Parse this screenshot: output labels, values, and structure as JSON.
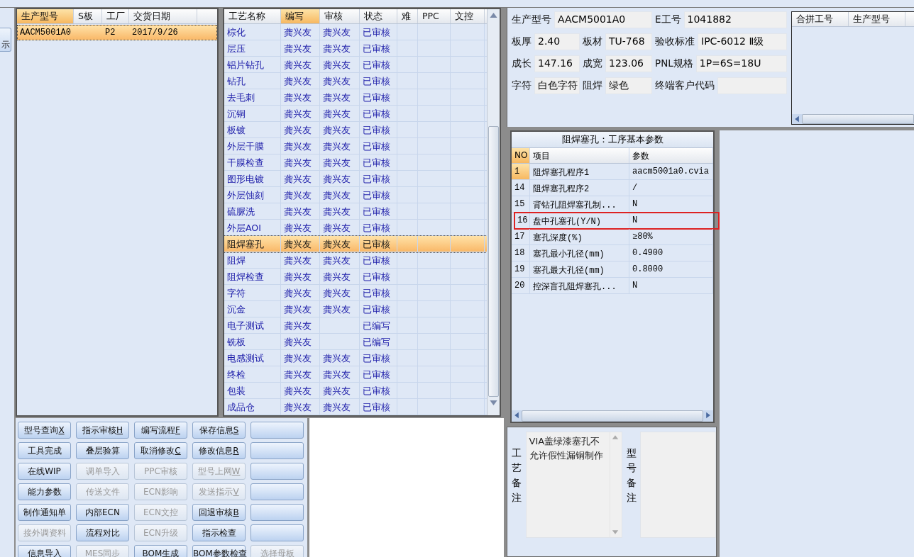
{
  "left_strip": {
    "button": "示"
  },
  "models_list": {
    "columns": [
      {
        "label": "生产型号",
        "sorted": true
      },
      {
        "label": "S板",
        "sorted": false
      },
      {
        "label": "工厂",
        "sorted": false
      },
      {
        "label": "交货日期",
        "sorted": false
      }
    ],
    "rows": [
      {
        "cells": [
          "AACM5001A0",
          "",
          "P2",
          "2017/9/26"
        ],
        "selected": true
      }
    ]
  },
  "process_table": {
    "columns": [
      {
        "label": "工艺名称",
        "sorted": false
      },
      {
        "label": "编写",
        "sorted": true
      },
      {
        "label": "审核",
        "sorted": false
      },
      {
        "label": "状态",
        "sorted": false
      },
      {
        "label": "难",
        "sorted": false
      },
      {
        "label": "PPC",
        "sorted": false
      },
      {
        "label": "文控",
        "sorted": false
      }
    ],
    "rows": [
      {
        "name": "棕化",
        "writer": "龚兴友",
        "reviewer": "龚兴友",
        "status": "已审核",
        "selected": false
      },
      {
        "name": "层压",
        "writer": "龚兴友",
        "reviewer": "龚兴友",
        "status": "已审核",
        "selected": false
      },
      {
        "name": "铝片钻孔",
        "writer": "龚兴友",
        "reviewer": "龚兴友",
        "status": "已审核",
        "selected": false
      },
      {
        "name": "钻孔",
        "writer": "龚兴友",
        "reviewer": "龚兴友",
        "status": "已审核",
        "selected": false
      },
      {
        "name": "去毛刺",
        "writer": "龚兴友",
        "reviewer": "龚兴友",
        "status": "已审核",
        "selected": false
      },
      {
        "name": "沉铜",
        "writer": "龚兴友",
        "reviewer": "龚兴友",
        "status": "已审核",
        "selected": false
      },
      {
        "name": "板镀",
        "writer": "龚兴友",
        "reviewer": "龚兴友",
        "status": "已审核",
        "selected": false
      },
      {
        "name": "外层干膜",
        "writer": "龚兴友",
        "reviewer": "龚兴友",
        "status": "已审核",
        "selected": false
      },
      {
        "name": "干膜检查",
        "writer": "龚兴友",
        "reviewer": "龚兴友",
        "status": "已审核",
        "selected": false
      },
      {
        "name": "图形电镀",
        "writer": "龚兴友",
        "reviewer": "龚兴友",
        "status": "已审核",
        "selected": false
      },
      {
        "name": "外层蚀刻",
        "writer": "龚兴友",
        "reviewer": "龚兴友",
        "status": "已审核",
        "selected": false
      },
      {
        "name": "硫脲洗",
        "writer": "龚兴友",
        "reviewer": "龚兴友",
        "status": "已审核",
        "selected": false
      },
      {
        "name": "外层AOI",
        "writer": "龚兴友",
        "reviewer": "龚兴友",
        "status": "已审核",
        "selected": false
      },
      {
        "name": "阻焊塞孔",
        "writer": "龚兴友",
        "reviewer": "龚兴友",
        "status": "已审核",
        "selected": true
      },
      {
        "name": "阻焊",
        "writer": "龚兴友",
        "reviewer": "龚兴友",
        "status": "已审核",
        "selected": false
      },
      {
        "name": "阻焊检查",
        "writer": "龚兴友",
        "reviewer": "龚兴友",
        "status": "已审核",
        "selected": false
      },
      {
        "name": "字符",
        "writer": "龚兴友",
        "reviewer": "龚兴友",
        "status": "已审核",
        "selected": false
      },
      {
        "name": "沉金",
        "writer": "龚兴友",
        "reviewer": "龚兴友",
        "status": "已审核",
        "selected": false
      },
      {
        "name": "电子测试",
        "writer": "龚兴友",
        "status": "已编写",
        "selected": false
      },
      {
        "name": "铣板",
        "writer": "龚兴友",
        "status": "已编写",
        "selected": false
      },
      {
        "name": "电感测试",
        "writer": "龚兴友",
        "reviewer": "龚兴友",
        "status": "已审核",
        "selected": false
      },
      {
        "name": "终检",
        "writer": "龚兴友",
        "reviewer": "龚兴友",
        "status": "已审核",
        "selected": false
      },
      {
        "name": "包装",
        "writer": "龚兴友",
        "reviewer": "龚兴友",
        "status": "已审核",
        "selected": false
      },
      {
        "name": "成品仓",
        "writer": "龚兴友",
        "reviewer": "龚兴友",
        "status": "已审核",
        "selected": false
      }
    ]
  },
  "buttons": [
    {
      "kind": "action",
      "label": "型号查询",
      "key": "X",
      "disabled": false
    },
    {
      "label": "指示审核",
      "key": "H",
      "disabled": false
    },
    {
      "label": "编写流程",
      "key": "F",
      "disabled": false
    },
    {
      "label": "保存信息",
      "key": "S",
      "disabled": false
    },
    {
      "kind": "blank",
      "disabled": false
    },
    {
      "label": "工具完成",
      "disabled": false
    },
    {
      "label": "叠层验算",
      "disabled": false
    },
    {
      "label": "取消修改",
      "key": "C",
      "disabled": false
    },
    {
      "label": "修改信息",
      "key": "R",
      "disabled": false
    },
    {
      "kind": "blank",
      "disabled": false
    },
    {
      "label": "在线WIP",
      "disabled": false
    },
    {
      "label": "调单导入",
      "disabled": true
    },
    {
      "label": "PPC审核",
      "disabled": true
    },
    {
      "label": "型号上网",
      "key": "W",
      "disabled": true
    },
    {
      "kind": "blank",
      "disabled": false
    },
    {
      "label": "能力参数",
      "disabled": false
    },
    {
      "label": "传送文件",
      "disabled": true
    },
    {
      "label": "ECN影响",
      "disabled": true
    },
    {
      "label": "发送指示",
      "key": "V",
      "disabled": true
    },
    {
      "kind": "blank",
      "disabled": false
    },
    {
      "label": "制作通知单",
      "disabled": false
    },
    {
      "label": "内部ECN",
      "disabled": false
    },
    {
      "label": "ECN文控",
      "disabled": true
    },
    {
      "label": "回退审核",
      "key": "B",
      "disabled": false
    },
    {
      "kind": "blank",
      "disabled": false
    },
    {
      "label": "接外调资料",
      "disabled": true
    },
    {
      "label": "流程对比",
      "disabled": false
    },
    {
      "label": "ECN升级",
      "disabled": true
    },
    {
      "label": "指示检查",
      "disabled": false
    },
    {
      "kind": "blank",
      "disabled": false
    },
    {
      "label": "信息导入",
      "disabled": false
    },
    {
      "label": "MES同步",
      "disabled": true
    },
    {
      "label": "BOM生成",
      "disabled": false
    },
    {
      "label": "BOM参数检查",
      "disabled": false
    },
    {
      "label": "选择母板",
      "disabled": true
    }
  ],
  "info": {
    "fields": [
      {
        "label": "生产型号",
        "value": "AACM5001A0"
      },
      {
        "label": "E工号",
        "value": "1041882"
      },
      {
        "label": "板厚",
        "value": "2.40"
      },
      {
        "label": "板材",
        "value": "TU-768"
      },
      {
        "label": "验收标准",
        "value": "IPC-6012 Ⅱ级"
      },
      {
        "label": "成长",
        "value": "147.16"
      },
      {
        "label": "成宽",
        "value": "123.06"
      },
      {
        "label": "PNL规格",
        "value": "1P=6S=18U"
      },
      {
        "label": "字符",
        "value": "白色字符"
      },
      {
        "label": "阻焊",
        "value": "绿色"
      },
      {
        "label": "终端客户代码"
      }
    ]
  },
  "merge_table": {
    "columns": [
      "合拼工号",
      "生产型号"
    ]
  },
  "params": {
    "title": "阻焊塞孔：工序基本参数",
    "columns": [
      "NO",
      "项目",
      "参数"
    ],
    "rows": [
      {
        "no": "1",
        "item": "阻焊塞孔程序1",
        "value": "aacm5001a0.cvia",
        "selected": true,
        "highlighted": false
      },
      {
        "no": "14",
        "item": "阻焊塞孔程序2",
        "value": "/",
        "selected": false,
        "highlighted": false
      },
      {
        "no": "15",
        "item": "背钻孔阻焊塞孔制...",
        "value": "N",
        "selected": false,
        "highlighted": false
      },
      {
        "no": "16",
        "item": "盘中孔塞孔(Y/N)",
        "value": "N",
        "selected": false,
        "highlighted": true
      },
      {
        "no": "17",
        "item": "塞孔深度(%)",
        "value": "≥80%",
        "selected": false,
        "highlighted": false
      },
      {
        "no": "18",
        "item": "塞孔最小孔径(mm)",
        "value": "0.4900",
        "selected": false,
        "highlighted": false
      },
      {
        "no": "19",
        "item": "塞孔最大孔径(mm)",
        "value": "0.8000",
        "selected": false,
        "highlighted": false
      },
      {
        "no": "20",
        "item": "控深盲孔阻焊塞孔...",
        "value": "N",
        "selected": false,
        "highlighted": false
      }
    ]
  },
  "remarks": {
    "process_label": "工艺备注",
    "process_text": "VIA盖绿漆塞孔不允许假性漏铜制作",
    "model_label": "型号备注"
  }
}
